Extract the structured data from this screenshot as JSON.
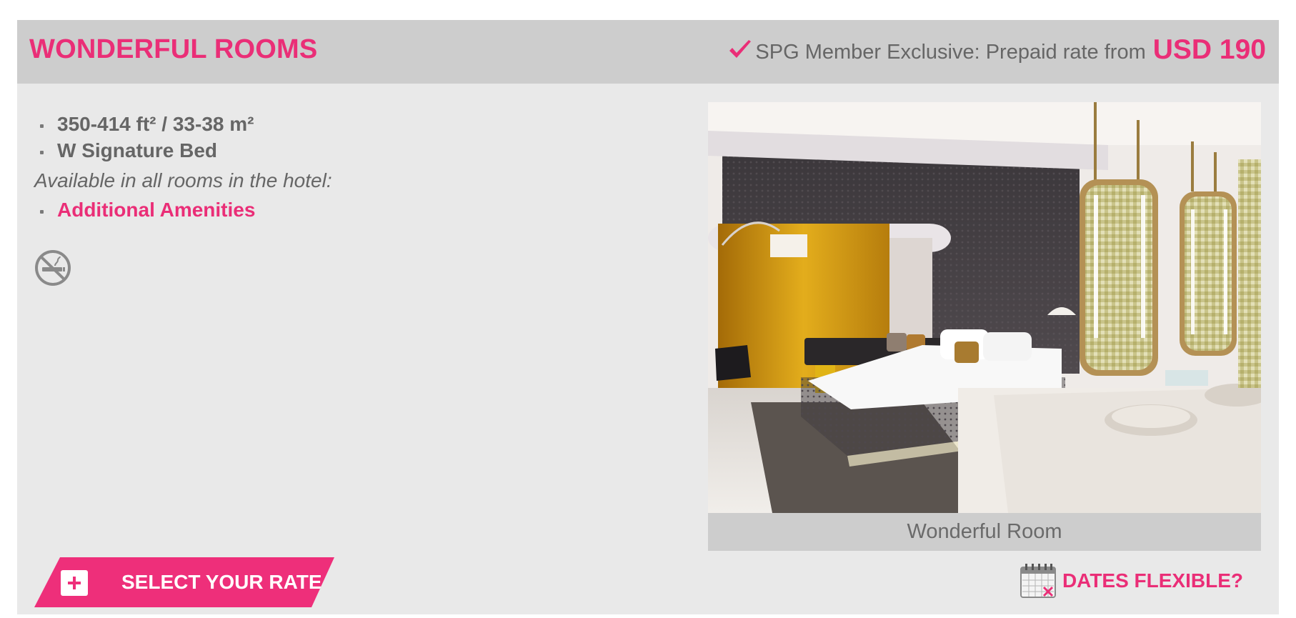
{
  "header": {
    "title": "WONDERFUL ROOMS",
    "rate_text": "SPG Member Exclusive: Prepaid rate from",
    "rate_price": "USD 190",
    "icon": "checkmark-icon"
  },
  "features": {
    "items": [
      "350-414 ft² / 33-38 m²",
      "W Signature Bed"
    ],
    "availability_note": "Available in all rooms in the hotel:",
    "amenities_link": "Additional Amenities",
    "policy_icon": "no-smoking-icon"
  },
  "photo": {
    "caption": "Wonderful Room"
  },
  "actions": {
    "select_rate_label": "SELECT YOUR RATE",
    "select_rate_icon": "plus-icon",
    "dates_flexible_label": "DATES FLEXIBLE?",
    "dates_flexible_icon": "calendar-icon"
  },
  "colors": {
    "accent": "#ea2e77",
    "header_bg": "#cdcdcd",
    "card_bg": "#e9e9e9",
    "text": "#666666"
  }
}
